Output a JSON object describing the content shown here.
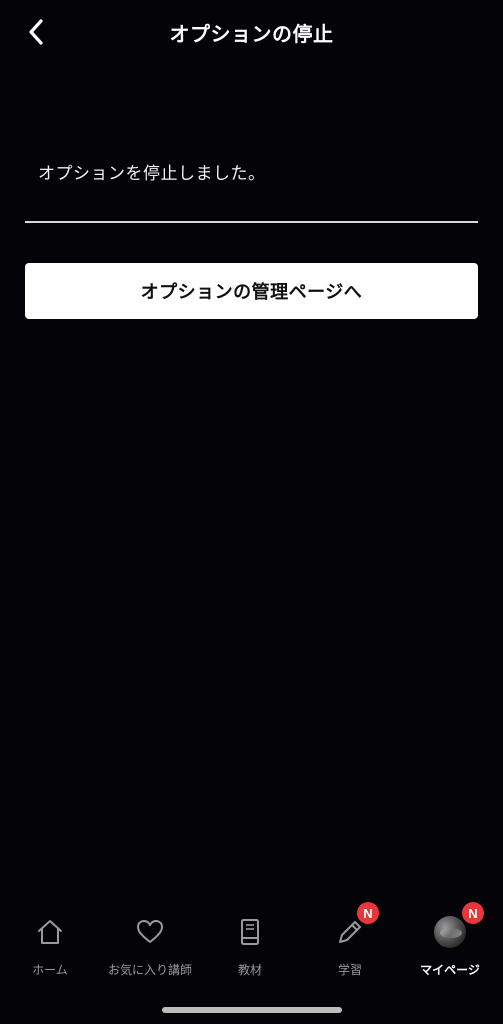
{
  "header": {
    "title": "オプションの停止",
    "back_icon": "chevron-left-icon"
  },
  "main": {
    "message": "オプションを停止しました。",
    "manage_button_label": "オプションの管理ページへ"
  },
  "tabbar": {
    "tabs": [
      {
        "label": "ホーム",
        "icon": "home-icon",
        "active": false
      },
      {
        "label": "お気に入り講師",
        "icon": "heart-icon",
        "active": false
      },
      {
        "label": "教材",
        "icon": "book-icon",
        "active": false
      },
      {
        "label": "学習",
        "icon": "pencil-icon",
        "active": false,
        "badge": "N"
      },
      {
        "label": "マイページ",
        "icon": "avatar",
        "active": true,
        "badge": "N"
      }
    ]
  },
  "colors": {
    "background": "#030308",
    "badge": "#e8363b",
    "inactive_tab": "#9a9a9a",
    "active_tab": "#ffffff"
  }
}
